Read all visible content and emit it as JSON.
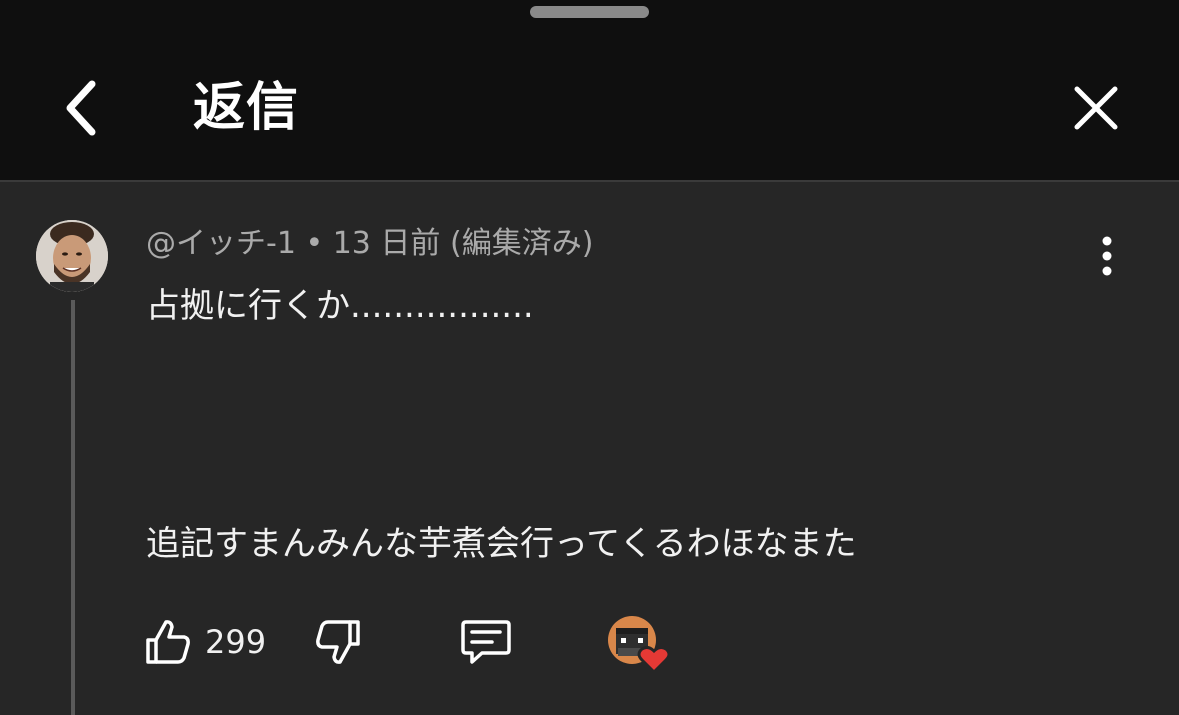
{
  "header": {
    "title": "返信",
    "back_icon": "chevron-left-icon",
    "close_icon": "close-icon"
  },
  "comment": {
    "author": "@イッチ-1",
    "separator": "•",
    "time": "13 日前",
    "edited": "(編集済み)",
    "lines": [
      "占拠に行くか.................",
      "追記すまんみんな芋煮会行ってくるわほなまた"
    ]
  },
  "actions": {
    "like_icon": "thumbs-up-icon",
    "like_count": "299",
    "dislike_icon": "thumbs-down-icon",
    "reply_icon": "reply-comment-icon",
    "creator_heart_icon": "creator-heart-icon"
  },
  "colors": {
    "header_bg": "#0f0f0f",
    "body_bg": "#262626",
    "meta_text": "#aaaaaa",
    "heart": "#e53935"
  }
}
